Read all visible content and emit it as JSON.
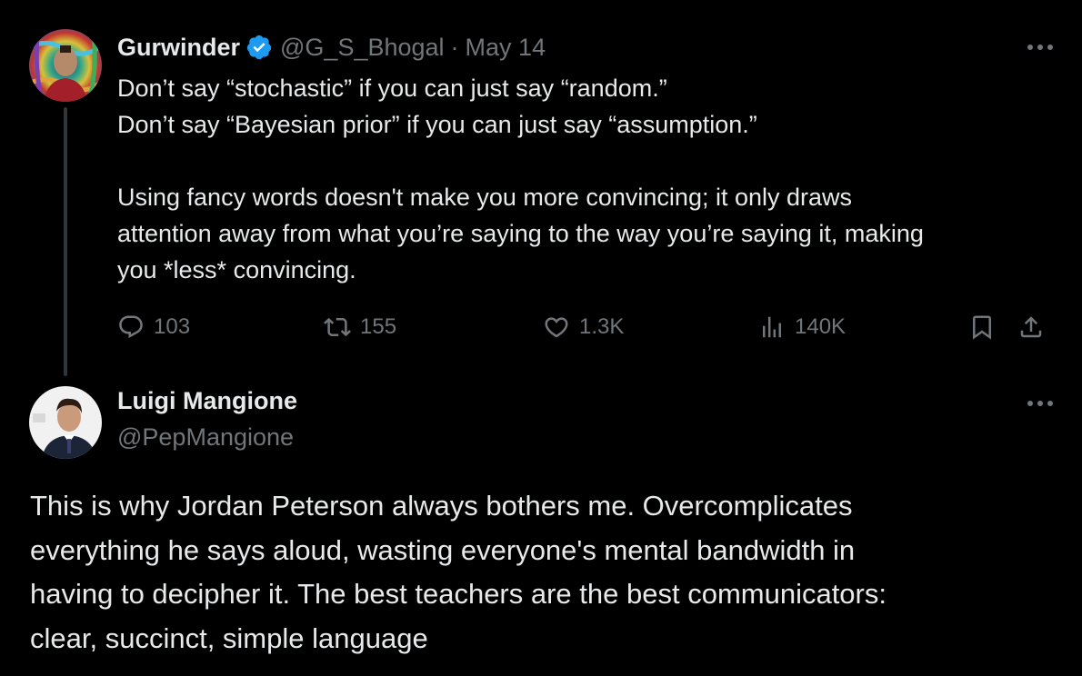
{
  "theme": {
    "background": "#000000",
    "text_primary": "#e7e9ea",
    "text_secondary": "#71767b",
    "verified_color": "#1d9bf0",
    "thread_line": "#333639"
  },
  "tweet1": {
    "author": {
      "display_name": "Gurwinder",
      "handle": "@G_S_Bhogal",
      "verified": true,
      "avatar_icon": "avatar-photo"
    },
    "separator": "·",
    "date": "May 14",
    "more_icon": "more-horizontal-icon",
    "lines": [
      "Don’t say “stochastic” if you can just say “random.”",
      "Don’t say “Bayesian prior” if you can just say “assumption.”",
      "",
      "Using fancy words doesn't make you more convincing; it only draws",
      "attention away from what you’re saying to the way you’re saying it, making",
      "you *less* convincing."
    ],
    "stats": {
      "replies": "103",
      "retweets": "155",
      "likes": "1.3K",
      "views": "140K"
    }
  },
  "tweet2": {
    "author": {
      "display_name": "Luigi Mangione",
      "handle": "@PepMangione",
      "avatar_icon": "avatar-photo"
    },
    "more_icon": "more-horizontal-icon",
    "lines": [
      "This is why Jordan Peterson always bothers me. Overcomplicates",
      "everything he says aloud, wasting everyone's mental bandwidth in",
      "having to decipher it. The best teachers are the best communicators:",
      "clear, succinct, simple language"
    ]
  }
}
